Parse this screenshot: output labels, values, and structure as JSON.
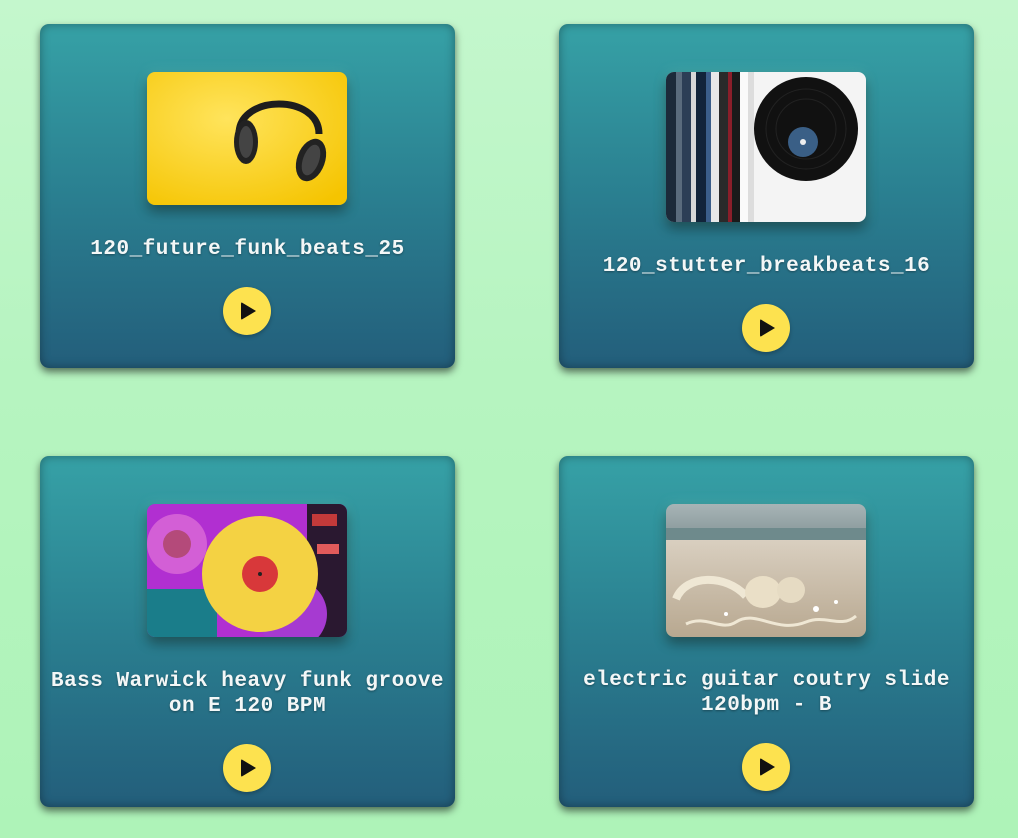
{
  "cards": [
    {
      "title": "120_future_funk_beats_25",
      "artwork": "headphones-on-yellow",
      "play_icon": "play-icon"
    },
    {
      "title": "120_stutter_breakbeats_16",
      "artwork": "vinyl-records",
      "play_icon": "play-icon"
    },
    {
      "title": "Bass Warwick heavy funk groove on E 120 BPM",
      "artwork": "colored-vinyl-records",
      "play_icon": "play-icon"
    },
    {
      "title": "electric guitar coutry slide 120bpm - B",
      "artwork": "earbuds-on-beach",
      "play_icon": "play-icon"
    }
  ],
  "colors": {
    "background": "#b6f4c0",
    "card_top": "#36a1a6",
    "card_bottom": "#235e7b",
    "play_button": "#fde24f",
    "title_text": "#f3f7f7"
  }
}
